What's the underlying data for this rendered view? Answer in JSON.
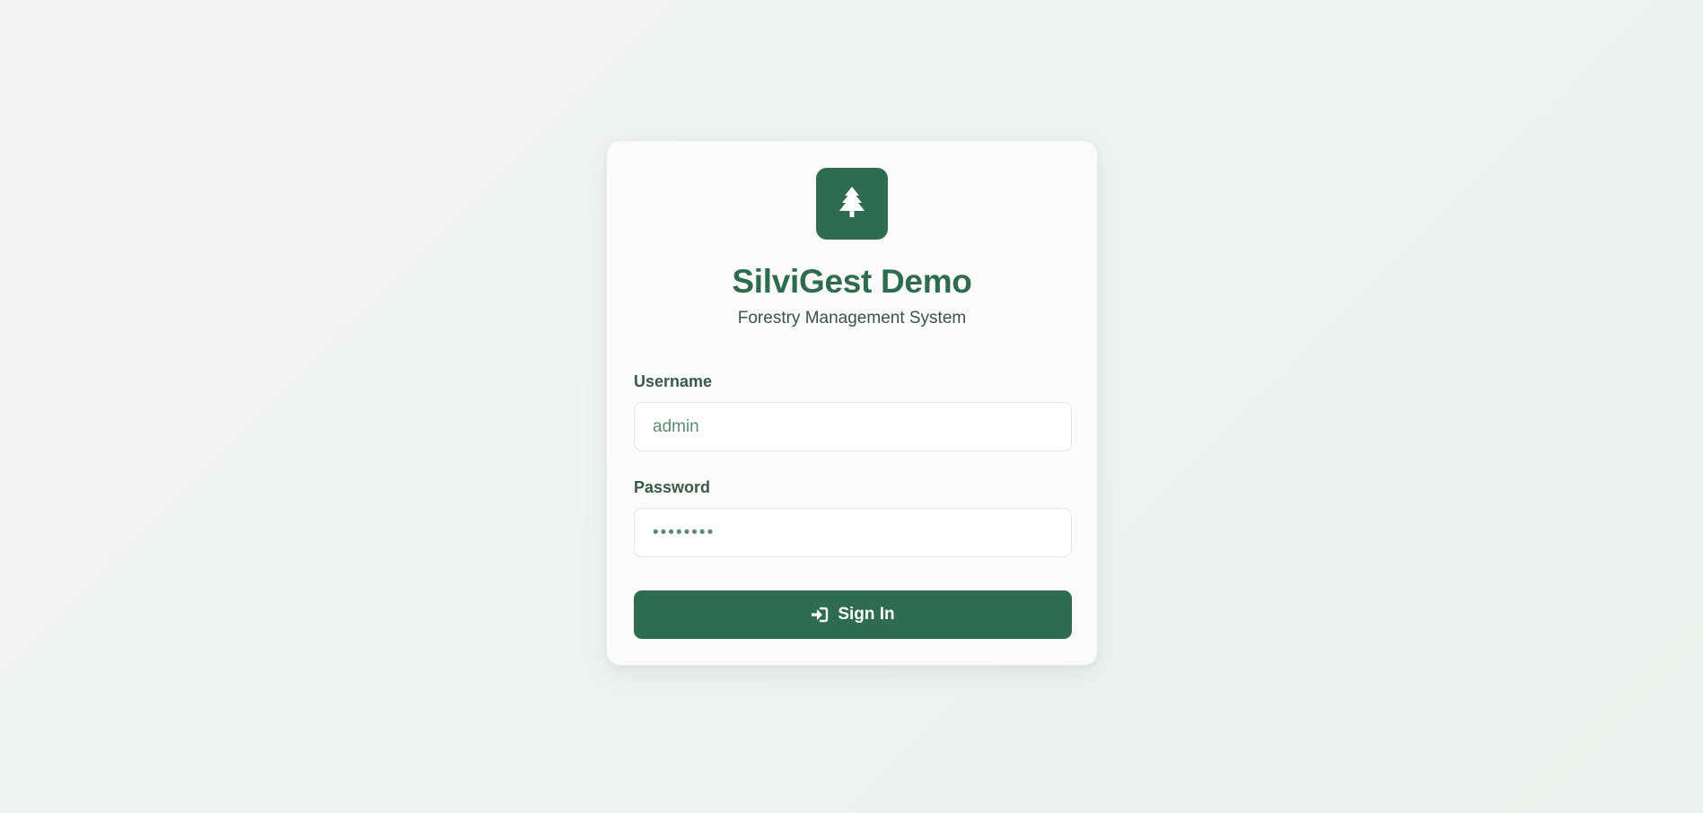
{
  "login": {
    "logo_icon": "tree-icon",
    "title": "SilviGest Demo",
    "subtitle": "Forestry Management System",
    "username_label": "Username",
    "username_value": "admin",
    "password_label": "Password",
    "password_value": "••••••••",
    "submit_label": "Sign In",
    "submit_icon": "sign-in-icon"
  },
  "colors": {
    "brand": "#2e6b50",
    "card_bg": "#fafbfa",
    "page_bg": "#f0f4f1"
  }
}
